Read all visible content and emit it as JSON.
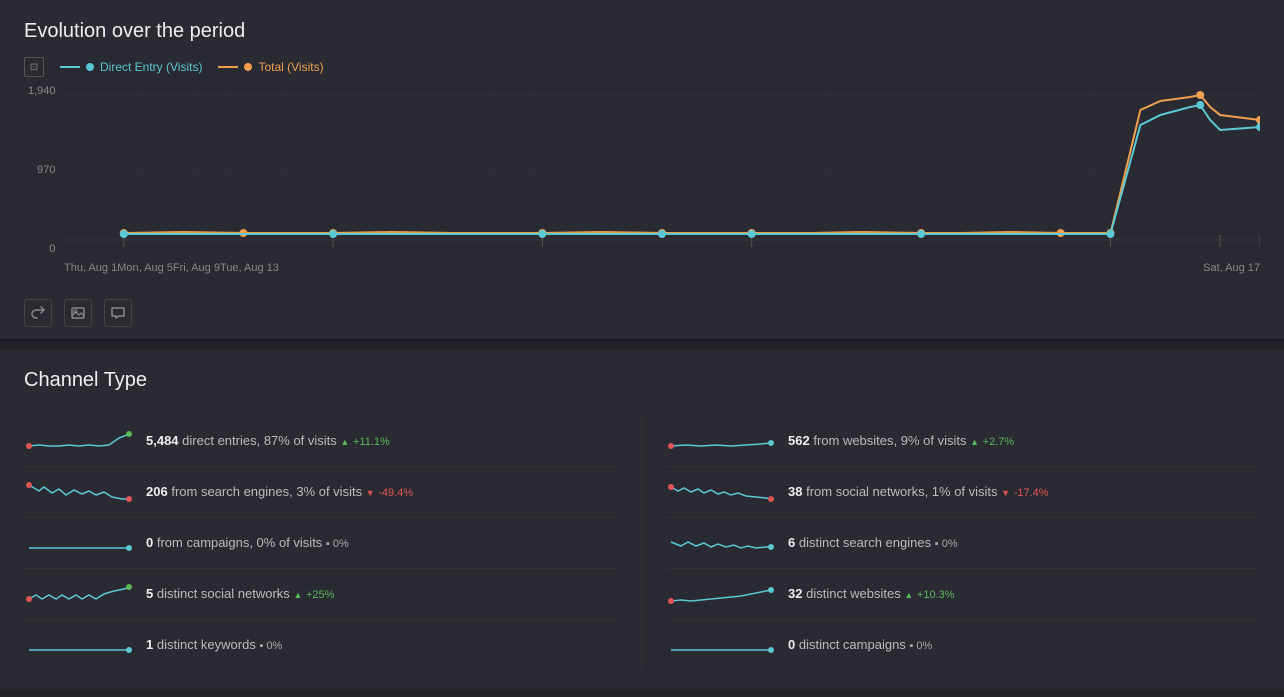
{
  "header": {
    "title": "Evolution over the period"
  },
  "legend": {
    "icon_label": "chart-icon",
    "items": [
      {
        "label": "Direct Entry (Visits)",
        "color": "#5bc8d4",
        "line_color": "#5bc8d4",
        "dot_color": "#5bc8d4"
      },
      {
        "label": "Total (Visits)",
        "color": "#f0a050",
        "line_color": "#f0a050",
        "dot_color": "#f0a050"
      }
    ]
  },
  "chart": {
    "y_axis": [
      "1,940",
      "970",
      "0"
    ],
    "x_axis": [
      "Thu, Aug 1",
      "Mon, Aug 5",
      "Fri, Aug 9",
      "Tue, Aug 13",
      "Sat, Aug 17",
      ""
    ]
  },
  "actions": [
    {
      "name": "share-button",
      "icon": "↗"
    },
    {
      "name": "image-button",
      "icon": "🖼"
    },
    {
      "name": "comment-button",
      "icon": "💬"
    }
  ],
  "section": {
    "title": "Channel Type"
  },
  "left_metrics": [
    {
      "value": "5,484",
      "label": "direct entries, 87% of visits",
      "change": "+11.1%",
      "change_type": "positive",
      "sparkline_type": "line_up",
      "dot_color": "#5cb85c"
    },
    {
      "value": "206",
      "label": "from search engines, 3% of visits",
      "change": "-49.4%",
      "change_type": "negative",
      "sparkline_type": "wavy",
      "dot_color": "#e05555"
    },
    {
      "value": "0",
      "label": "from campaigns, 0% of visits",
      "change": "0%",
      "change_type": "neutral",
      "sparkline_type": "flat",
      "dot_color": "#5bc8d4"
    },
    {
      "value": "5",
      "label": "distinct social networks",
      "change": "+25%",
      "change_type": "positive",
      "sparkline_type": "wavy_up",
      "dot_color": "#5cb85c"
    },
    {
      "value": "1",
      "label": "distinct keywords",
      "change": "0%",
      "change_type": "neutral",
      "sparkline_type": "flat_low",
      "dot_color": "#5bc8d4"
    }
  ],
  "right_metrics": [
    {
      "value": "562",
      "label": "from websites, 9% of visits",
      "change": "+2.7%",
      "change_type": "positive",
      "sparkline_type": "line_flat",
      "dot_color": "#5bc8d4"
    },
    {
      "value": "38",
      "label": "from social networks, 1% of visits",
      "change": "-17.4%",
      "change_type": "negative",
      "sparkline_type": "wavy_flat",
      "dot_color": "#e05555"
    },
    {
      "value": "6",
      "label": "distinct search engines",
      "change": "0%",
      "change_type": "neutral",
      "sparkline_type": "wavy_low",
      "dot_color": "#5bc8d4"
    },
    {
      "value": "32",
      "label": "distinct websites",
      "change": "+10.3%",
      "change_type": "positive",
      "sparkline_type": "line_up2",
      "dot_color": "#5bc8d4"
    },
    {
      "value": "0",
      "label": "distinct campaigns",
      "change": "0%",
      "change_type": "neutral",
      "sparkline_type": "flat_long",
      "dot_color": "#5bc8d4"
    }
  ]
}
